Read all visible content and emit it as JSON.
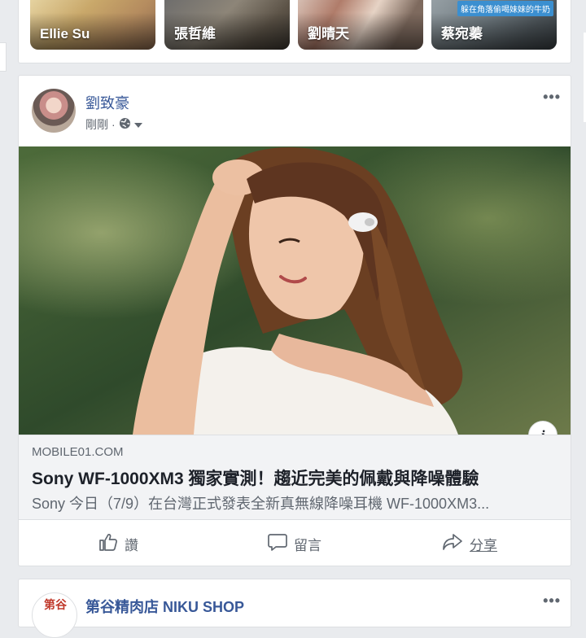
{
  "stories": [
    {
      "name": "Ellie Su",
      "tagline": ""
    },
    {
      "name": "張哲維",
      "tagline": ""
    },
    {
      "name": "劉晴天",
      "tagline": ""
    },
    {
      "name": "蔡宛蓁",
      "tagline": "躲在角落偷喝妹妹的牛奶"
    }
  ],
  "post": {
    "author": "劉致豪",
    "time": "剛剛",
    "separator": "·",
    "more_icon": "more-options-icon",
    "link": {
      "domain": "MOBILE01.COM",
      "title": "Sony WF-1000XM3 獨家實測！趨近完美的佩戴與降噪體驗",
      "description": "Sony 今日（7/9）在台灣正式發表全新真無線降噪耳機 WF-1000XM3..."
    },
    "info_label": "i",
    "actions": {
      "like": "讚",
      "comment": "留言",
      "share": "分享"
    }
  },
  "next_post": {
    "author": "第谷精肉店 NIKU SHOP",
    "avatar_text": "第谷"
  }
}
